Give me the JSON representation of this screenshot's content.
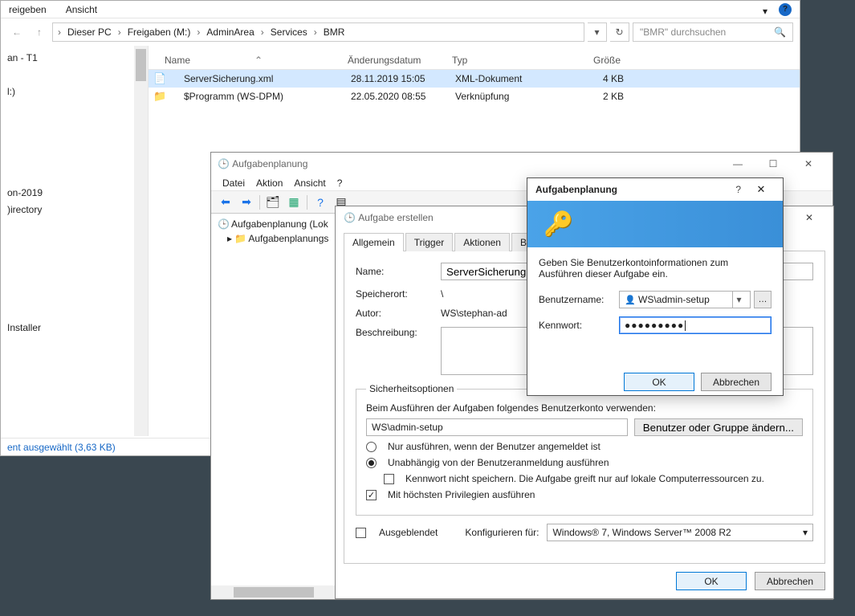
{
  "explorer": {
    "menu": [
      "reigeben",
      "Ansicht"
    ],
    "breadcrumbs": [
      "Dieser PC",
      "Freigaben (M:)",
      "AdminArea",
      "Services",
      "BMR"
    ],
    "search_placeholder": "\"BMR\" durchsuchen",
    "columns": {
      "name": "Name",
      "date": "Änderungsdatum",
      "type": "Typ",
      "size": "Größe"
    },
    "rows": [
      {
        "icon": "📄",
        "name": "ServerSicherung.xml",
        "date": "28.11.2019 15:05",
        "type": "XML-Dokument",
        "size": "4 KB",
        "selected": true
      },
      {
        "icon": "📁",
        "name": "$Programm (WS-DPM)",
        "date": "22.05.2020 08:55",
        "type": "Verknüpfung",
        "size": "2 KB",
        "selected": false
      }
    ],
    "tree": [
      "an - T1",
      "",
      "l:)",
      "",
      "",
      "",
      "",
      "",
      "on-2019",
      ")irectory",
      "",
      "",
      "",
      "",
      "",
      "",
      "Installer"
    ],
    "status": "ent ausgewählt (3,63 KB)"
  },
  "tasksched": {
    "title": "Aufgabenplanung",
    "menu": [
      "Datei",
      "Aktion",
      "Ansicht",
      "?"
    ],
    "tree": [
      "Aufgabenplanung (Lok",
      "Aufgabenplanungs"
    ]
  },
  "createtask": {
    "title": "Aufgabe erstellen",
    "tabs": [
      "Allgemein",
      "Trigger",
      "Aktionen",
      "Bedingun"
    ],
    "labels": {
      "name": "Name:",
      "location": "Speicherort:",
      "author": "Autor:",
      "description": "Beschreibung:",
      "security_legend": "Sicherheitsoptionen",
      "security_prompt": "Beim Ausführen der Aufgaben folgendes Benutzerkonto verwenden:",
      "change_user_btn": "Benutzer oder Gruppe ändern...",
      "run_logged_on": "Nur ausführen, wenn der Benutzer angemeldet ist",
      "run_whether": "Unabhängig von der Benutzeranmeldung ausführen",
      "no_store_pw": "Kennwort nicht speichern. Die Aufgabe greift nur auf lokale Computerressourcen zu.",
      "highest_priv": "Mit höchsten Privilegien ausführen",
      "hidden": "Ausgeblendet",
      "configure_for": "Konfigurieren für:",
      "ok": "OK",
      "cancel": "Abbrechen"
    },
    "values": {
      "name": "ServerSicherung",
      "location": "\\",
      "author": "WS\\stephan-ad",
      "description": "",
      "user_account": "WS\\admin-setup",
      "configure_for": "Windows® 7, Windows Server™ 2008 R2",
      "highest_priv_checked": true
    }
  },
  "creddlg": {
    "title": "Aufgabenplanung",
    "prompt": "Geben Sie Benutzerkontoinformationen zum Ausführen dieser Aufgabe ein.",
    "username_label": "Benutzername:",
    "password_label": "Kennwort:",
    "username": "WS\\admin-setup",
    "password_mask": "●●●●●●●●●",
    "ok": "OK",
    "cancel": "Abbrechen"
  }
}
